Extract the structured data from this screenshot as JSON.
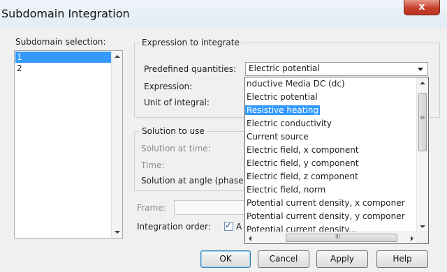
{
  "window": {
    "title": "Subdomain Integration",
    "close_glyph": "x"
  },
  "subdomain": {
    "label": "Subdomain selection:",
    "items": [
      "1",
      "2"
    ],
    "selected_index": 0
  },
  "expression_group": {
    "title": "Expression to integrate",
    "predefined_label": "Predefined quantities:",
    "predefined_value": "Electric potential",
    "expression_label": "Expression:",
    "unit_label": "Unit of integral:"
  },
  "dropdown": {
    "items": [
      "nductive Media DC (dc)",
      "Electric potential",
      "Resistive heating",
      "Electric conductivity",
      "Current source",
      "Electric field, x component",
      "Electric field, y component",
      "Electric field, z component",
      "Electric field, norm",
      "Potential current density, x componer",
      "Potential current density, y componer",
      "Potential current density..."
    ],
    "highlighted_index": 2,
    "scroll_grip": "≡",
    "hscroll_grip": "III"
  },
  "solution_group": {
    "title": "Solution to use",
    "time_label": "Solution at time:",
    "time2_label": "Time:",
    "angle_label": "Solution at angle (phase"
  },
  "frame_label": "Frame:",
  "integration_order": {
    "label": "Integration order:",
    "checkbox_label": "A",
    "checked": true
  },
  "buttons": {
    "ok": "OK",
    "cancel": "Cancel",
    "apply": "Apply",
    "help": "Help"
  },
  "colors": {
    "selection": "#3399ff",
    "close": "#c7402c"
  }
}
